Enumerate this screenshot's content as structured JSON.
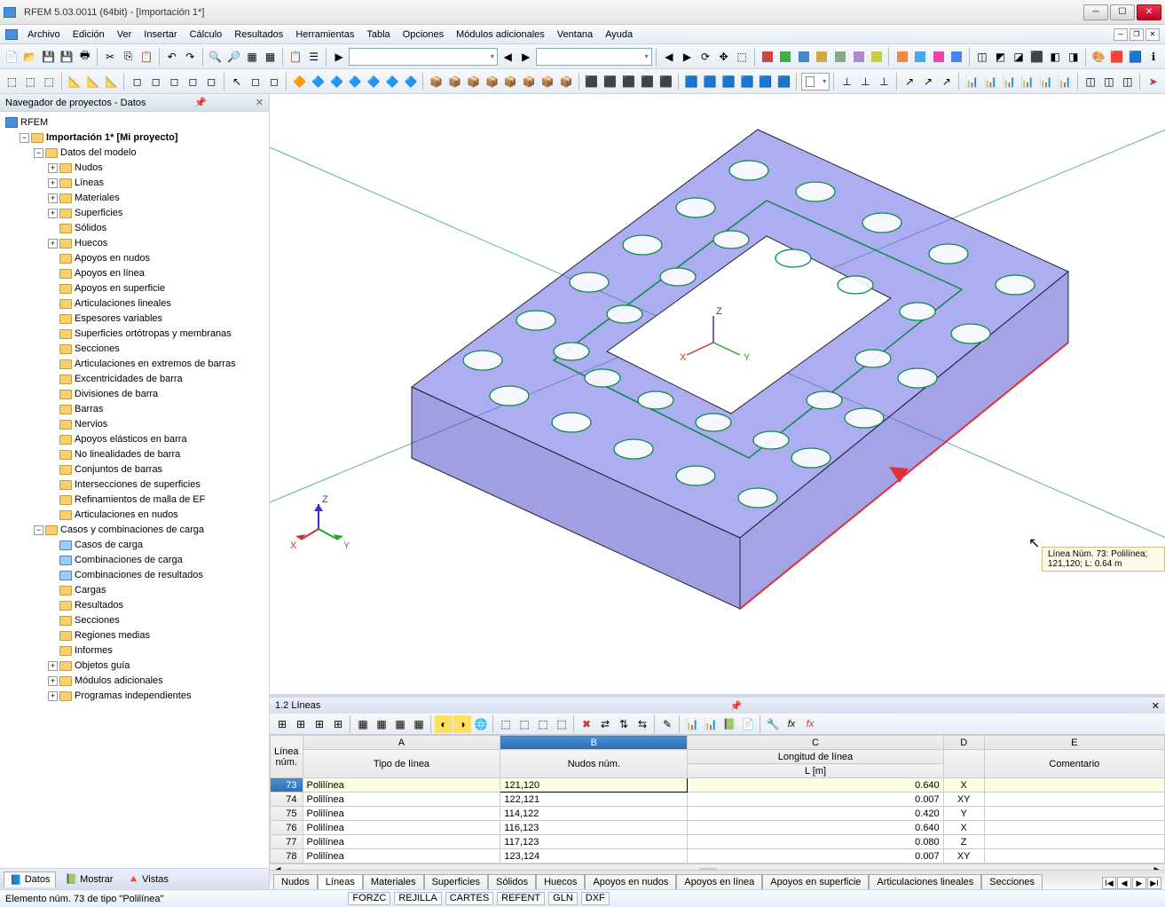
{
  "app": {
    "title": "RFEM 5.03.0011 (64bit) - [Importación 1*]"
  },
  "menus": [
    "Archivo",
    "Edición",
    "Ver",
    "Insertar",
    "Cálculo",
    "Resultados",
    "Herramientas",
    "Tabla",
    "Opciones",
    "Módulos adicionales",
    "Ventana",
    "Ayuda"
  ],
  "navigator": {
    "title": "Navegador de proyectos - Datos",
    "root": "RFEM",
    "project": "Importación 1* [Mi proyecto]",
    "model_data": "Datos del modelo",
    "items": [
      "Nudos",
      "Líneas",
      "Materiales",
      "Superficies",
      "Sólidos",
      "Huecos",
      "Apoyos en nudos",
      "Apoyos en línea",
      "Apoyos en superficie",
      "Articulaciones lineales",
      "Espesores variables",
      "Superficies ortótropas y membranas",
      "Secciones",
      "Articulaciones en extremos de barras",
      "Excentricidades de barra",
      "Divisiones de barra",
      "Barras",
      "Nervios",
      "Apoyos elásticos en barra",
      "No linealidades de barra",
      "Conjuntos de barras",
      "Intersecciones de superficies",
      "Refinamientos de malla de EF",
      "Articulaciones en nudos"
    ],
    "cases_parent": "Casos y combinaciones de carga",
    "cases": [
      "Casos de carga",
      "Combinaciones de carga",
      "Combinaciones de resultados"
    ],
    "rest": [
      "Cargas",
      "Resultados",
      "Secciones",
      "Regiones medias",
      "Informes",
      "Objetos guía",
      "Módulos adicionales",
      "Programas independientes"
    ],
    "tabs": [
      "Datos",
      "Mostrar",
      "Vistas"
    ]
  },
  "viewport": {
    "tooltip": "Línea Núm. 73: Polilínea; 121,120; L: 0.64 m",
    "axes": [
      "X",
      "Y",
      "Z"
    ]
  },
  "table_panel": {
    "title": "1.2 Líneas",
    "col_letters": [
      "A",
      "B",
      "C",
      "D",
      "E"
    ],
    "header1": {
      "row_label": "Línea\nnúm.",
      "type": "Tipo de línea",
      "nodes": "Nudos núm.",
      "len_top": "Longitud de línea",
      "len_unit": "L [m]",
      "comment": "Comentario"
    },
    "rows": [
      {
        "num": "73",
        "type": "Polilínea",
        "nodes": "121,120",
        "len": "0.640",
        "dir": "X",
        "sel": true
      },
      {
        "num": "74",
        "type": "Polilínea",
        "nodes": "122,121",
        "len": "0.007",
        "dir": "XY"
      },
      {
        "num": "75",
        "type": "Polilínea",
        "nodes": "114,122",
        "len": "0.420",
        "dir": "Y"
      },
      {
        "num": "76",
        "type": "Polilínea",
        "nodes": "116,123",
        "len": "0.640",
        "dir": "X"
      },
      {
        "num": "77",
        "type": "Polilínea",
        "nodes": "117,123",
        "len": "0.080",
        "dir": "Z"
      },
      {
        "num": "78",
        "type": "Polilínea",
        "nodes": "123,124",
        "len": "0.007",
        "dir": "XY"
      }
    ],
    "tabs": [
      "Nudos",
      "Líneas",
      "Materiales",
      "Superficies",
      "Sólidos",
      "Huecos",
      "Apoyos en nudos",
      "Apoyos en línea",
      "Apoyos en superficie",
      "Articulaciones lineales",
      "Secciones"
    ],
    "active_tab": 1
  },
  "status": {
    "left": "Elemento núm. 73 de tipo \"Polilínea\"",
    "segs": [
      "FORZC",
      "REJILLA",
      "CARTES",
      "REFENT",
      "GLN",
      "DXF"
    ]
  },
  "toolbars": {
    "row1_icons": [
      "📄",
      "📂",
      "💾",
      "🖶",
      "",
      "✂",
      "📋",
      "📋",
      "↩",
      "↪",
      "",
      "🔍",
      "🔍",
      "",
      "▦",
      "▦",
      "",
      "📋",
      "",
      "⬜"
    ],
    "row2_icons": [
      "🧊",
      "🧊",
      "🧊",
      "",
      "📦",
      "📦",
      "",
      "📐",
      "📐",
      "",
      "🔧",
      "🔧",
      "",
      "🎨",
      "🎨"
    ]
  }
}
